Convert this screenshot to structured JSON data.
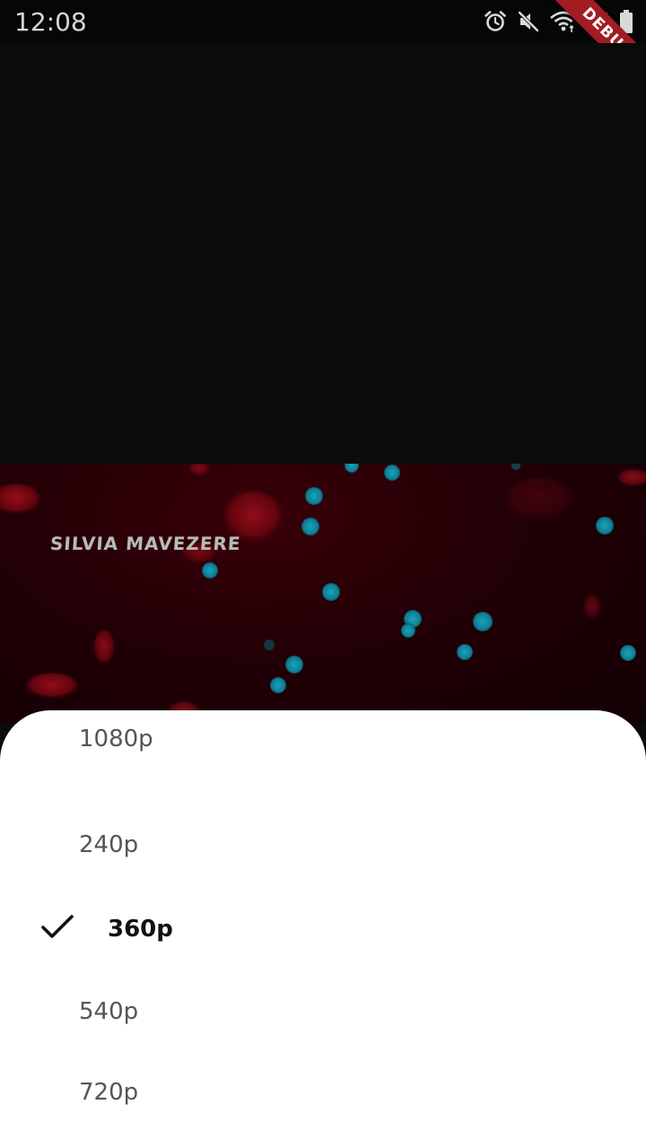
{
  "status_bar": {
    "time": "12:08",
    "icons": [
      "alarm-icon",
      "mute-icon",
      "wifi-icon",
      "signal-icon",
      "battery-icon"
    ]
  },
  "debug_banner": {
    "label": "DEBUG",
    "color": "#a31c24"
  },
  "video": {
    "overlay_text": "SILVIA MAVEZERE"
  },
  "quality_menu": {
    "options": [
      {
        "label": "1080p",
        "selected": false
      },
      {
        "label": "240p",
        "selected": false
      },
      {
        "label": "360p",
        "selected": true
      },
      {
        "label": "540p",
        "selected": false
      },
      {
        "label": "720p",
        "selected": false
      }
    ],
    "selected_icon": "check-icon"
  }
}
